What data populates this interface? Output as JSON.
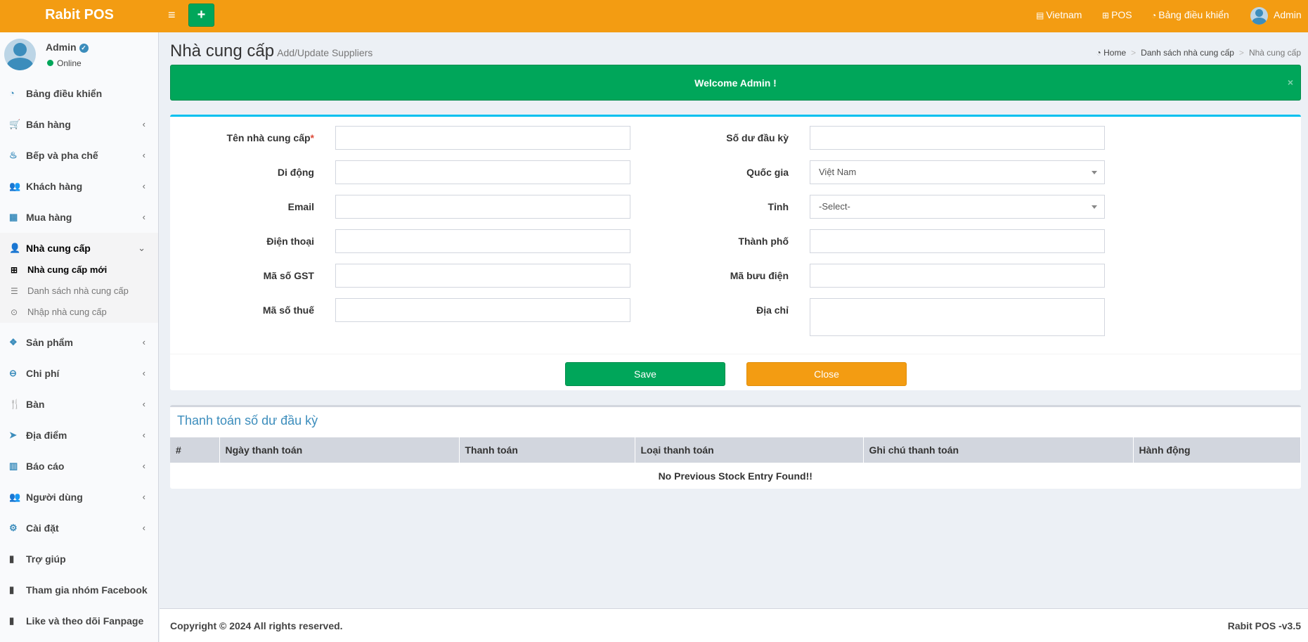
{
  "header": {
    "logo": "Rabit POS",
    "hamburger_glyph": "≡",
    "plus_glyph": "+",
    "nav": {
      "language": "Vietnam",
      "pos": "POS",
      "dashboard": "Bảng điều khiển",
      "user": "Admin"
    },
    "colors": {
      "bar": "#f39c12",
      "plus_button": "#00a65a"
    }
  },
  "sidebar": {
    "user": {
      "name": "Admin",
      "status": "Online",
      "verified_icon": "check-circle-icon"
    },
    "items": [
      {
        "label": "Bảng điều khiển",
        "icon": "dashboard-icon",
        "glyph": "◔",
        "chevron": ""
      },
      {
        "label": "Bán hàng",
        "icon": "cart-icon",
        "glyph": "🛒",
        "chevron": "‹"
      },
      {
        "label": "Bếp và pha chế",
        "icon": "kitchen-icon",
        "glyph": "♨",
        "chevron": "‹"
      },
      {
        "label": "Khách hàng",
        "icon": "users-icon",
        "glyph": "👥",
        "chevron": "‹"
      },
      {
        "label": "Mua hàng",
        "icon": "grid-icon",
        "glyph": "▦",
        "chevron": "‹"
      },
      {
        "label": "Nhà cung cấp",
        "icon": "user-plus-icon",
        "glyph": "👤",
        "chevron": "⌄"
      },
      {
        "label": "Sản phẩm",
        "icon": "cubes-icon",
        "glyph": "❖",
        "chevron": "‹"
      },
      {
        "label": "Chi phí",
        "icon": "minus-circle-icon",
        "glyph": "⊖",
        "chevron": "‹"
      },
      {
        "label": "Bàn",
        "icon": "cutlery-icon",
        "glyph": "🍴",
        "chevron": "‹"
      },
      {
        "label": "Địa điểm",
        "icon": "paper-plane-icon",
        "glyph": "➤",
        "chevron": "‹"
      },
      {
        "label": "Báo cáo",
        "icon": "bar-chart-icon",
        "glyph": "▥",
        "chevron": "‹"
      },
      {
        "label": "Người dùng",
        "icon": "users-icon",
        "glyph": "👥",
        "chevron": "‹"
      },
      {
        "label": "Cài đặt",
        "icon": "gears-icon",
        "glyph": "⚙",
        "chevron": "‹"
      },
      {
        "label": "Trợ giúp",
        "icon": "book-icon",
        "glyph": "▮",
        "chevron": ""
      },
      {
        "label": "Tham gia nhóm Facebook",
        "icon": "briefcase-icon",
        "glyph": "▮",
        "chevron": ""
      },
      {
        "label": "Like và theo dõi Fanpage",
        "icon": "briefcase-icon",
        "glyph": "▮",
        "chevron": ""
      }
    ],
    "submenu": [
      {
        "label": "Nhà cung cấp mới",
        "icon": "plus-square-icon",
        "glyph": "⊞"
      },
      {
        "label": "Danh sách nhà cung cấp",
        "icon": "list-icon",
        "glyph": "☰"
      },
      {
        "label": "Nhập nhà cung cấp",
        "icon": "arrow-circle-icon",
        "glyph": "⊙"
      }
    ]
  },
  "page": {
    "title": "Nhà cung cấp",
    "subtitle": "Add/Update Suppliers",
    "breadcrumb": {
      "home": "Home",
      "list": "Danh sách nhà cung cấp",
      "current": "Nhà cung cấp",
      "separator": ">"
    }
  },
  "alert": {
    "message": "Welcome Admin !",
    "close": "×",
    "color": "#00a65a"
  },
  "form": {
    "left": [
      {
        "label": "Tên nhà cung cấp",
        "required": "*",
        "value": ""
      },
      {
        "label": "Di động",
        "value": ""
      },
      {
        "label": "Email",
        "value": ""
      },
      {
        "label": "Điện thoại",
        "value": ""
      },
      {
        "label": "Mã số GST",
        "value": ""
      },
      {
        "label": "Mã số thuế",
        "value": ""
      }
    ],
    "right": [
      {
        "label": "Số dư đầu kỳ",
        "value": ""
      },
      {
        "label": "Quốc gia",
        "value": "Việt Nam"
      },
      {
        "label": "Tỉnh",
        "value": "-Select-"
      },
      {
        "label": "Thành phố",
        "value": ""
      },
      {
        "label": "Mã bưu điện",
        "value": ""
      },
      {
        "label": "Địa chỉ",
        "value": ""
      }
    ],
    "save": "Save",
    "close": "Close"
  },
  "payments": {
    "title": "Thanh toán số dư đầu kỳ",
    "columns": [
      "#",
      "Ngày thanh toán",
      "Thanh toán",
      "Loại thanh toán",
      "Ghi chú thanh toán",
      "Hành động"
    ],
    "empty": "No Previous Stock Entry Found!!"
  },
  "footer": {
    "copyright": "Copyright © 2024 All rights reserved.",
    "version": "Rabit POS -v3.5"
  }
}
